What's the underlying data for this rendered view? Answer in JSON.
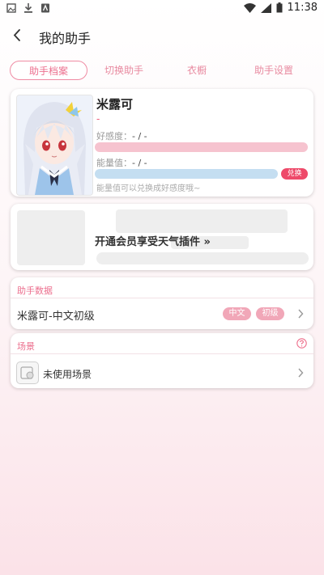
{
  "status_bar": {
    "time": "11:38"
  },
  "header": {
    "title": "我的助手"
  },
  "tabs": [
    {
      "label": "助手档案",
      "active": true
    },
    {
      "label": "切换助手",
      "active": false
    },
    {
      "label": "衣橱",
      "active": false
    },
    {
      "label": "助手设置",
      "active": false
    }
  ],
  "profile": {
    "name": "米露可",
    "sub": "-",
    "favor_label": "好感度：",
    "favor_value": "- / -",
    "energy_label": "能量值：",
    "energy_value": "- / -",
    "exchange_label": "兑换",
    "hint": "能量值可以兑换成好感度哦~"
  },
  "promo": {
    "text": "开通会员享受天气插件 »"
  },
  "assistant_data": {
    "title": "助手数据",
    "row_text": "米露可-中文初级",
    "badges": [
      "中文",
      "初级"
    ]
  },
  "scene": {
    "title": "场景",
    "row_text": "未使用场景"
  },
  "colors": {
    "accent": "#ec6f8e",
    "favor_bar": "#f6c3cf",
    "energy_bar": "#c4def1",
    "exchange": "#ee4a6a"
  }
}
